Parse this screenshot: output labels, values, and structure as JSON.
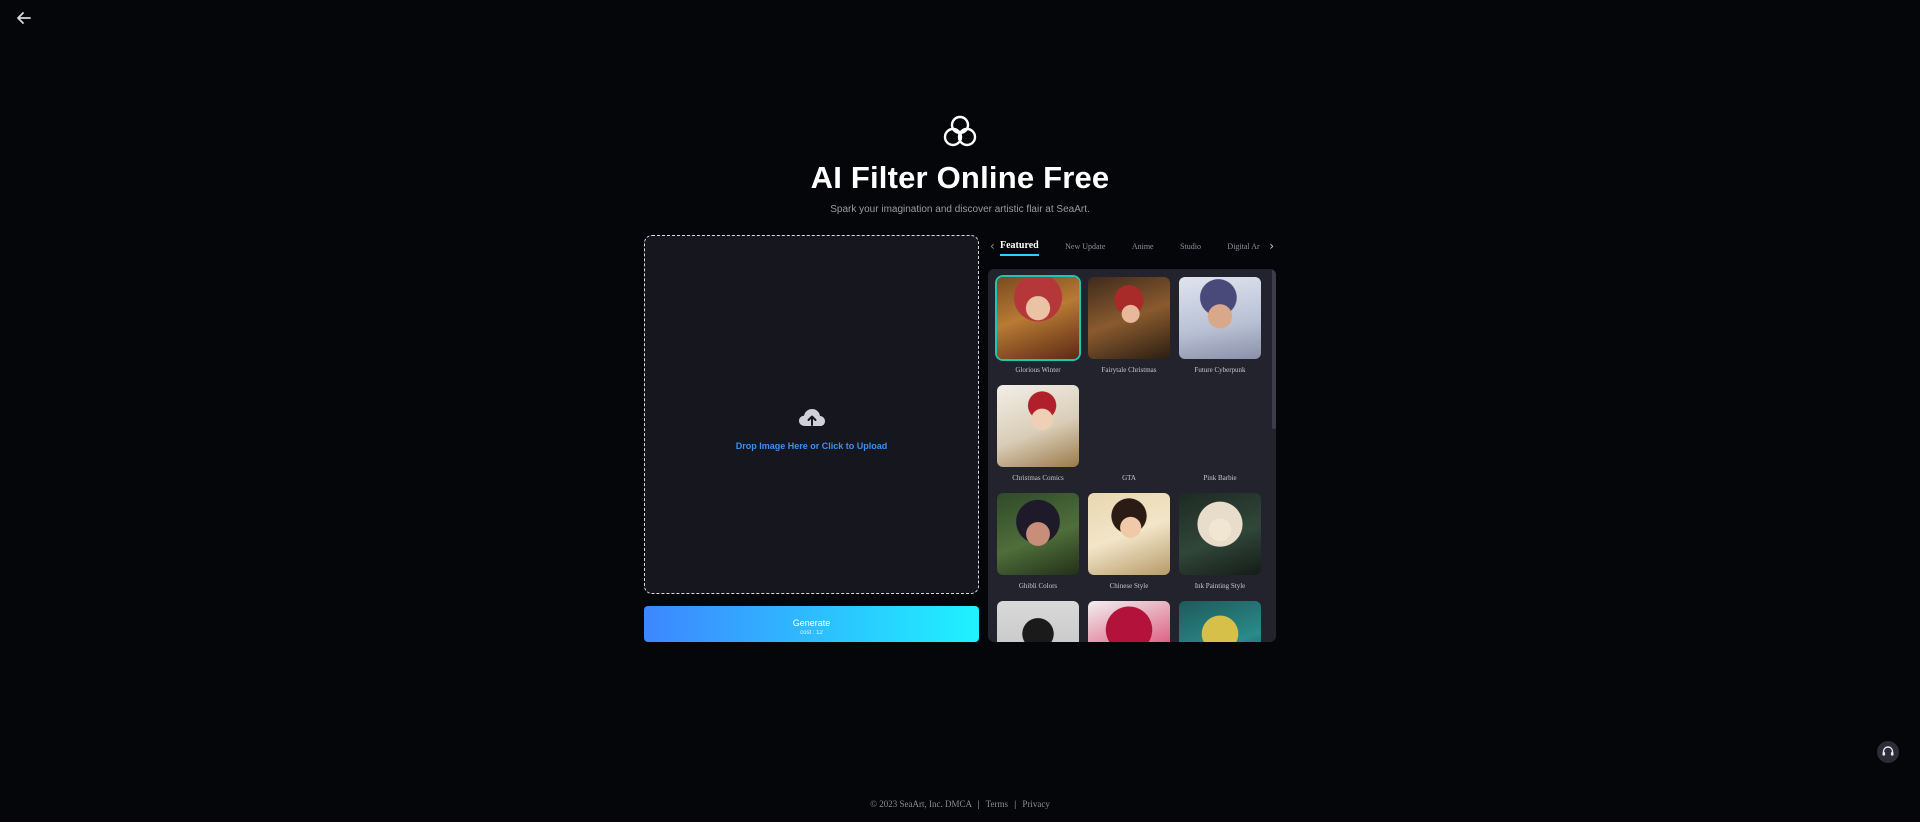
{
  "nav": {
    "back_icon": "arrow-left-icon"
  },
  "hero": {
    "logo_icon": "three-circles-logo-icon",
    "title": "AI Filter Online Free",
    "subtitle": "Spark your imagination and discover artistic flair at SeaArt."
  },
  "upload": {
    "icon": "cloud-upload-icon",
    "text": "Drop Image Here or Click to Upload"
  },
  "generate": {
    "label": "Generate",
    "cost": "cost : 12",
    "colors": {
      "start": "#3d86ff",
      "end": "#1ff2ff"
    }
  },
  "tabs": {
    "items": [
      "Featured",
      "New Update",
      "Anime",
      "Studio",
      "Digital Ar"
    ],
    "active": "Featured",
    "prev_icon": "chevron-left-icon",
    "next_icon": "chevron-right-icon"
  },
  "gallery": {
    "items": [
      {
        "label": "Glorious Winter"
      },
      {
        "label": "Fairytale Christmas"
      },
      {
        "label": "Future Cyberpunk"
      },
      {
        "label": "Christmas Comics"
      },
      {
        "label": "GTA"
      },
      {
        "label": "Pink Barbie"
      },
      {
        "label": "Ghibli Colors"
      },
      {
        "label": "Chinese Style"
      },
      {
        "label": "Ink Painting Style"
      },
      {
        "label": ""
      },
      {
        "label": ""
      },
      {
        "label": ""
      }
    ],
    "selected": "Glorious Winter",
    "accent": "#20c4b5"
  },
  "footer": {
    "copyright": "© 2023 SeaArt, Inc. DMCA",
    "terms": "Terms",
    "privacy": "Privacy"
  },
  "support": {
    "icon": "headset-support-icon"
  }
}
